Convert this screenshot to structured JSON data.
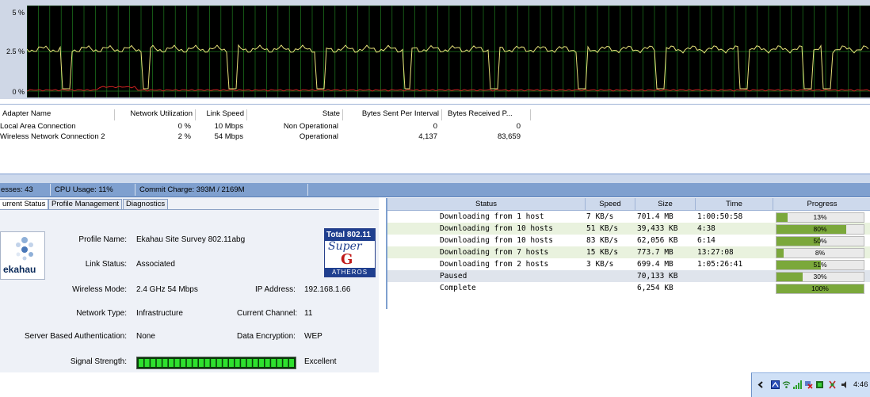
{
  "graph": {
    "y_labels": [
      "5 %",
      "2.5 %",
      "0 %"
    ]
  },
  "adapter_table": {
    "headers": [
      "Adapter Name",
      "Network Utilization",
      "Link Speed",
      "State",
      "Bytes Sent Per Interval",
      "Bytes Received P..."
    ],
    "rows": [
      {
        "name": "Local Area Connection",
        "util": "0 %",
        "speed": "10 Mbps",
        "state": "Non Operational",
        "sent": "0",
        "received": "0"
      },
      {
        "name": "Wireless Network Connection 2",
        "util": "2 %",
        "speed": "54 Mbps",
        "state": "Operational",
        "sent": "4,137",
        "received": "83,659"
      }
    ]
  },
  "statusbar": {
    "processes": "esses: 43",
    "cpu": "CPU Usage: 11%",
    "commit": "Commit Charge: 393M / 2169M"
  },
  "ekahau": {
    "tabs": [
      "urrent Status",
      "Profile Management",
      "Diagnostics"
    ],
    "logo_text": "ekahau",
    "atheros": {
      "line1": "Total 802.11",
      "line2": "Super",
      "line3": "G",
      "line4": "ATHEROS"
    },
    "fields": {
      "profile_name_label": "Profile Name:",
      "profile_name": "Ekahau Site Survey 802.11abg",
      "link_status_label": "Link Status:",
      "link_status": "Associated",
      "wireless_mode_label": "Wireless Mode:",
      "wireless_mode": "2.4 GHz 54 Mbps",
      "ip_label": "IP Address:",
      "ip": "192.168.1.66",
      "network_type_label": "Network Type:",
      "network_type": "Infrastructure",
      "channel_label": "Current Channel:",
      "channel": "11",
      "auth_label": "Server Based Authentication:",
      "auth": "None",
      "encryption_label": "Data Encryption:",
      "encryption": "WEP",
      "signal_label": "Signal Strength:",
      "signal": "Excellent"
    },
    "signal_level": 1.0
  },
  "downloads": {
    "headers": [
      "Status",
      "Speed",
      "Size",
      "Time",
      "Progress"
    ],
    "rows": [
      {
        "status": "Downloading from 1 host",
        "speed": "7 KB/s",
        "size": "701.4 MB",
        "time": "1:00:50:58",
        "progress": "13%",
        "pct": 13
      },
      {
        "status": "Downloading from 10 hosts",
        "speed": "51 KB/s",
        "size": "39,433 KB",
        "time": "4:38",
        "progress": "80%",
        "pct": 80
      },
      {
        "status": "Downloading from 10 hosts",
        "speed": "83 KB/s",
        "size": "62,056 KB",
        "time": "6:14",
        "progress": "50%",
        "pct": 50
      },
      {
        "status": "Downloading from 7 hosts",
        "speed": "15 KB/s",
        "size": "773.7 MB",
        "time": "13:27:08",
        "progress": "8%",
        "pct": 8
      },
      {
        "status": "Downloading from 2 hosts",
        "speed": "3 KB/s",
        "size": "699.4 MB",
        "time": "1:05:26:41",
        "progress": "51%",
        "pct": 51
      },
      {
        "status": "Paused",
        "speed": "",
        "size": "70,133 KB",
        "time": "",
        "progress": "30%",
        "pct": 30
      },
      {
        "status": "Complete",
        "speed": "",
        "size": "6,254 KB",
        "time": "",
        "progress": "100%",
        "pct": 100
      }
    ]
  },
  "tray": {
    "clock": "4:46",
    "icons": [
      "chevron-left-icon",
      "network-icon",
      "wifi-icon",
      "signal-bars-icon",
      "network-disconnected-icon",
      "antivirus-icon",
      "safely-remove-icon"
    ]
  },
  "colors": {
    "graph_bg": "#000000",
    "graph_grid": "#1f7a1f",
    "wireless_trace": "#e8e27a",
    "lan_trace": "#d22222",
    "progress_fill": "#7ba83b",
    "signal_fill": "#2ee02e"
  }
}
